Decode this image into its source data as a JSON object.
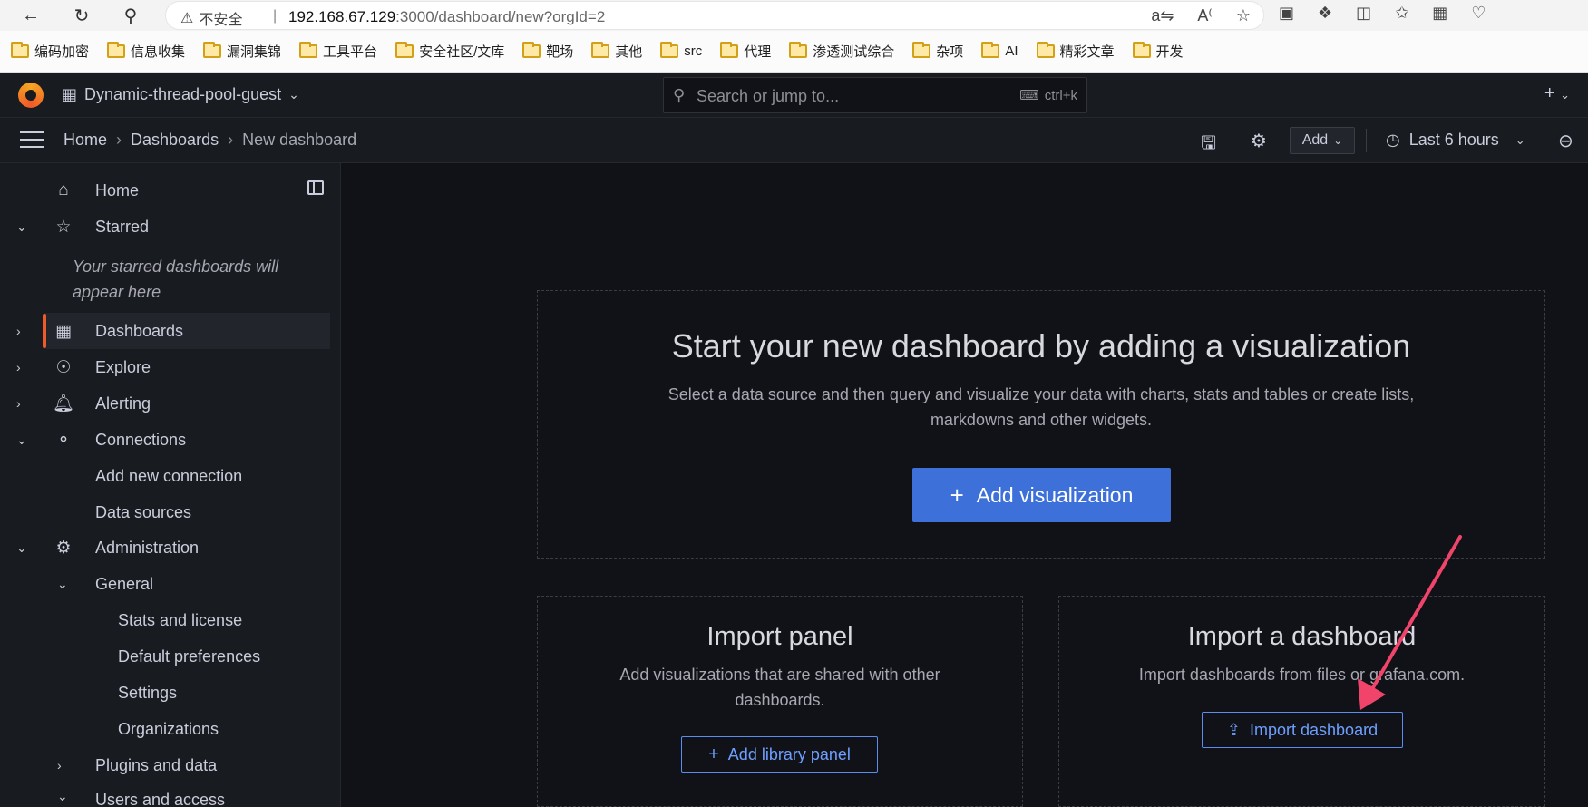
{
  "browser": {
    "security_label": "不安全",
    "url_host": "192.168.67.129",
    "url_rest": ":3000/dashboard/new?orgId=2",
    "bookmarks": [
      "编码加密",
      "信息收集",
      "漏洞集锦",
      "工具平台",
      "安全社区/文库",
      "靶场",
      "其他",
      "src",
      "代理",
      "渗透测试综合",
      "杂项",
      "AI",
      "精彩文章",
      "开发"
    ]
  },
  "header": {
    "org_name": "Dynamic-thread-pool-guest",
    "search_placeholder": "Search or jump to...",
    "search_shortcut": "ctrl+k"
  },
  "breadcrumb": {
    "home": "Home",
    "dashboards": "Dashboards",
    "current": "New dashboard"
  },
  "toolbar": {
    "add_label": "Add",
    "time_range": "Last 6 hours"
  },
  "sidebar": {
    "home": "Home",
    "starred": "Starred",
    "starred_note": "Your starred dashboards will appear here",
    "dashboards": "Dashboards",
    "explore": "Explore",
    "alerting": "Alerting",
    "connections": "Connections",
    "add_new_connection": "Add new connection",
    "data_sources": "Data sources",
    "administration": "Administration",
    "general": "General",
    "stats_license": "Stats and license",
    "default_preferences": "Default preferences",
    "settings": "Settings",
    "organizations": "Organizations",
    "plugins_data": "Plugins and data",
    "users_access": "Users and access"
  },
  "main": {
    "hero_title": "Start your new dashboard by adding a visualization",
    "hero_desc_line1": "Select a data source and then query and visualize your data with charts, stats and tables or create lists,",
    "hero_desc_line2": "markdowns and other widgets.",
    "add_visualization": "Add visualization",
    "import_panel_title": "Import panel",
    "import_panel_desc_line1": "Add visualizations that are shared with other",
    "import_panel_desc_line2": "dashboards.",
    "add_library_panel": "Add library panel",
    "import_dashboard_title": "Import a dashboard",
    "import_dashboard_desc": "Import dashboards from files or grafana.com.",
    "import_dashboard_button": "Import dashboard"
  },
  "colors": {
    "primary": "#3d71d9",
    "accent": "#f05a28",
    "annotation_arrow": "#f0446a"
  }
}
